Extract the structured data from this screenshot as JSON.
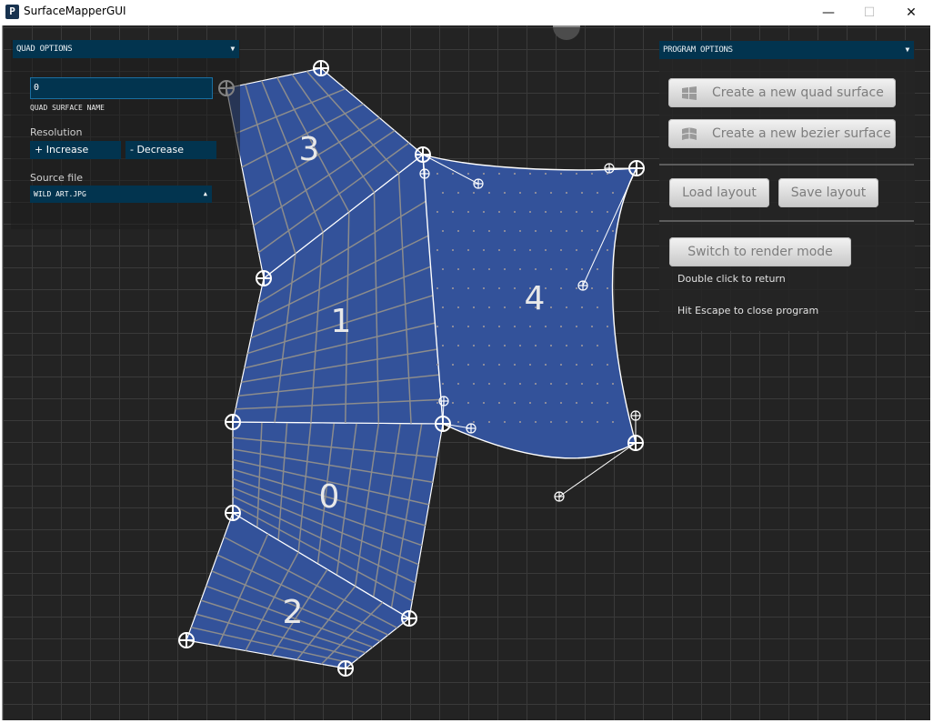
{
  "window": {
    "title": "SurfaceMapperGUI",
    "app_icon_glyph": "P",
    "controls": {
      "minimize": "—",
      "maximize": "☐",
      "close": "✕"
    }
  },
  "quad_options": {
    "header": "QUAD OPTIONS",
    "caret": "▼",
    "surface_name_value": "0",
    "surface_name_caption": "QUAD SURFACE NAME",
    "resolution_label": "Resolution",
    "increase_label": "+ Increase",
    "decrease_label": "- Decrease",
    "source_file_label": "Source file",
    "source_file_value": "WILD ART.JPG",
    "source_caret": "▲"
  },
  "program_options": {
    "header": "PROGRAM OPTIONS",
    "caret": "▼",
    "create_quad_label": "Create a new quad surface",
    "create_bezier_label": "Create a new bezier surface",
    "load_layout_label": "Load layout",
    "save_layout_label": "Save layout",
    "render_mode_label": "Switch to render mode",
    "double_click_note": "Double click to return",
    "escape_note": "Hit Escape to close program"
  },
  "surfaces": [
    {
      "id": "0",
      "type": "quad"
    },
    {
      "id": "1",
      "type": "quad"
    },
    {
      "id": "2",
      "type": "quad"
    },
    {
      "id": "3",
      "type": "quad"
    },
    {
      "id": "4",
      "type": "bezier"
    }
  ],
  "colors": {
    "surface_fill": "#33529a",
    "grid_line": "#8c8c8c",
    "panel_header": "#02344f",
    "canvas_bg": "#232323"
  }
}
